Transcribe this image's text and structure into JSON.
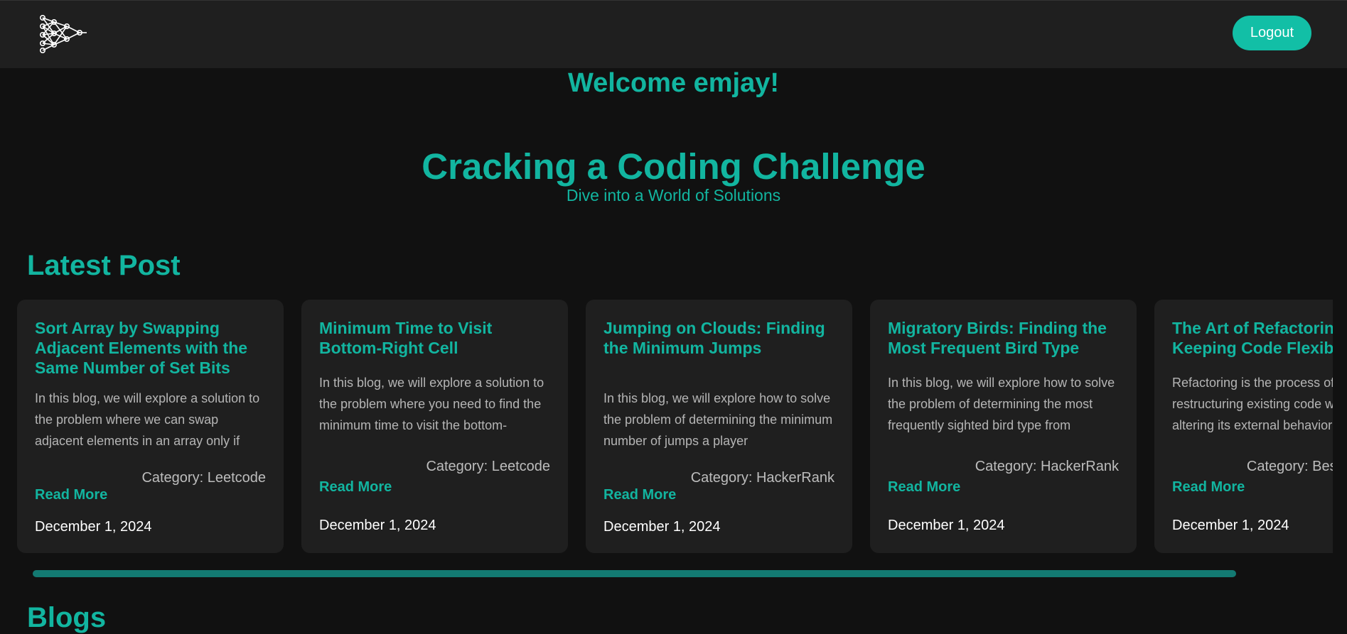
{
  "header": {
    "logo_icon": "neural-network-icon",
    "logout_label": "Logout",
    "accent_color": "#12b5a0"
  },
  "welcome": "Welcome emjay!",
  "hero": {
    "title": "Cracking a Coding Challenge",
    "subtitle": "Dive into a World of Solutions"
  },
  "latest": {
    "heading": "Latest Post",
    "posts": [
      {
        "title": "Sort Array by Swapping Adjacent Elements with the Same Number of Set Bits",
        "excerpt": "In this blog, we will explore a solution to the problem where we can swap adjacent elements in an array only if",
        "category": "Category: Leetcode",
        "read_more": "Read More",
        "date": "December 1, 2024"
      },
      {
        "title": "Minimum Time to Visit Bottom-Right Cell",
        "excerpt": "In this blog, we will explore a solution to the problem where you need to find the minimum time to visit the bottom-",
        "category": "Category: Leetcode",
        "read_more": "Read More",
        "date": "December 1, 2024"
      },
      {
        "title": "Jumping on Clouds: Finding the Minimum Jumps",
        "excerpt": "In this blog, we will explore how to solve the problem of determining the minimum number of jumps a player",
        "category": "Category: HackerRank",
        "read_more": "Read More",
        "date": "December 1, 2024"
      },
      {
        "title": "Migratory Birds: Finding the Most Frequent Bird Type",
        "excerpt": "In this blog, we will explore how to solve the problem of determining the most frequently sighted bird type from",
        "category": "Category: HackerRank",
        "read_more": "Read More",
        "date": "December 1, 2024"
      },
      {
        "title": "The Art of Refactoring: Keeping Code Flexible",
        "excerpt": "Refactoring is the process of restructuring existing code without altering its external behavior",
        "category": "Category: Best Practices",
        "read_more": "Read More",
        "date": "December 1, 2024"
      }
    ]
  },
  "blogs_heading": "Blogs"
}
